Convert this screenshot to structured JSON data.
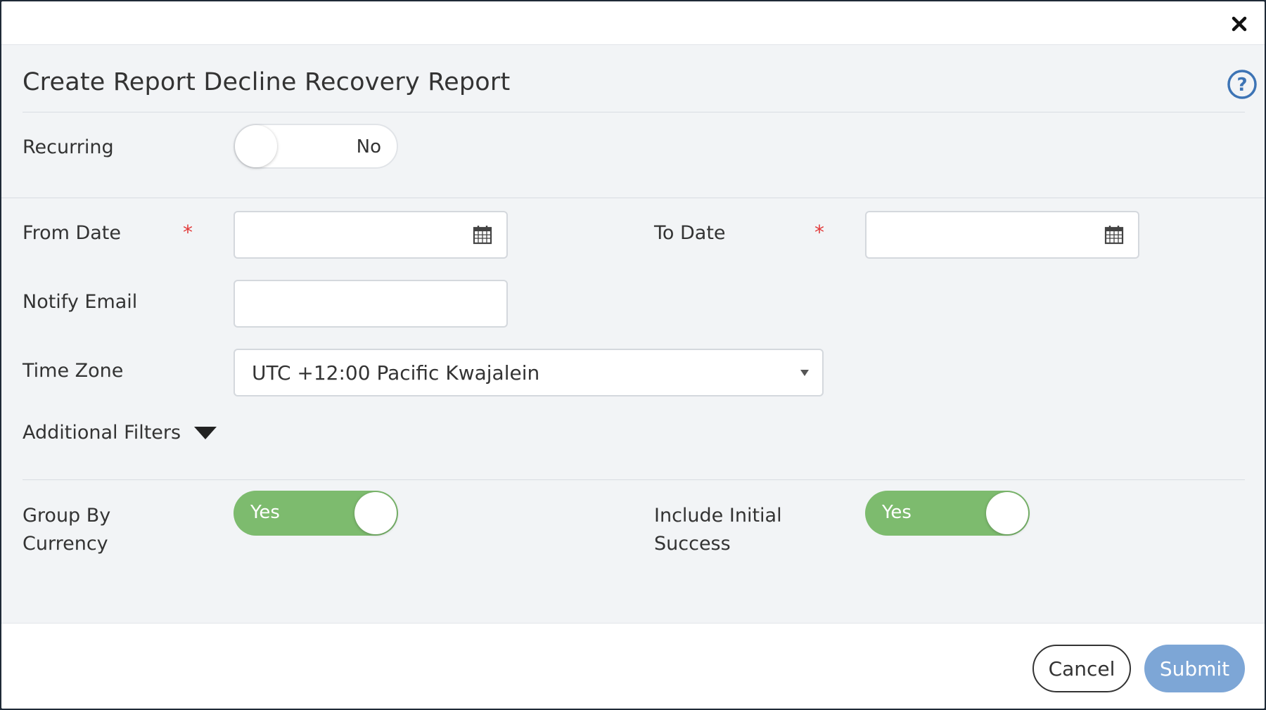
{
  "dialog": {
    "title": "Create Report Decline Recovery Report"
  },
  "form": {
    "recurring": {
      "label": "Recurring",
      "value": "No",
      "on": false
    },
    "from_date": {
      "label": "From Date",
      "required_mark": "*",
      "value": ""
    },
    "to_date": {
      "label": "To Date",
      "required_mark": "*",
      "value": ""
    },
    "notify_email": {
      "label": "Notify Email",
      "value": ""
    },
    "time_zone": {
      "label": "Time Zone",
      "selected": "UTC +12:00 Pacific Kwajalein"
    },
    "additional_filters": {
      "label": "Additional Filters"
    },
    "group_by_currency": {
      "label_line1": "Group By",
      "label_line2": "Currency",
      "value": "Yes",
      "on": true
    },
    "include_initial_success": {
      "label_line1": "Include Initial",
      "label_line2": "Success",
      "value": "Yes",
      "on": true
    }
  },
  "footer": {
    "cancel_label": "Cancel",
    "submit_label": "Submit"
  },
  "colors": {
    "toggle_on": "#7dbb6e",
    "submit": "#7da6d6",
    "required": "#e23b3b",
    "help": "#3d74b5"
  },
  "icons": [
    "close-icon",
    "help-icon",
    "calendar-icon",
    "chevron-down-icon",
    "triangle-down-icon"
  ]
}
